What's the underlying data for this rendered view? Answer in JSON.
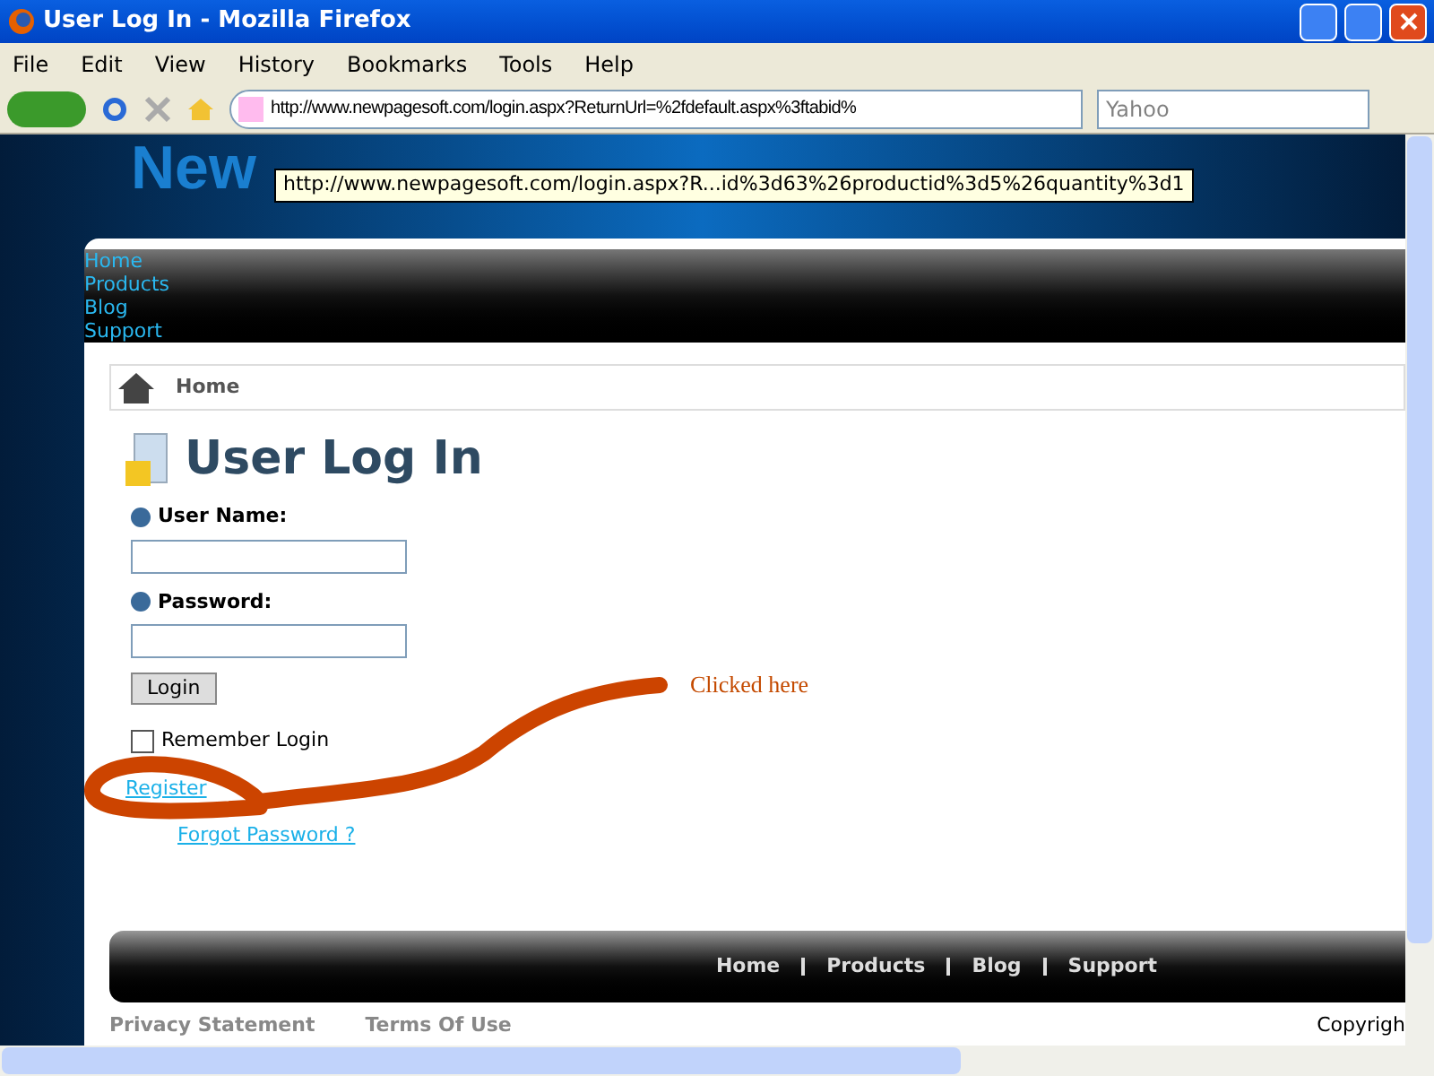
{
  "window": {
    "title": "User Log In - Mozilla Firefox"
  },
  "menu": [
    "File",
    "Edit",
    "View",
    "History",
    "Bookmarks",
    "Tools",
    "Help"
  ],
  "address": {
    "value": "http://www.newpagesoft.com/login.aspx?ReturnUrl=%2fdefault.aspx%3ftabid%"
  },
  "search": {
    "placeholder": "Yahoo"
  },
  "logo": {
    "parts": [
      {
        "text": "New",
        "color": "#1a7fd0"
      }
    ]
  },
  "tooltip": "http://www.newpagesoft.com/login.aspx?R...id%3d63%26productid%3d5%26quantity%3d1",
  "nav": [
    "Home",
    "Products",
    "Blog",
    "Support"
  ],
  "breadcrumb": "Home",
  "heading": "User Log In",
  "form": {
    "username_label": "User Name:",
    "password_label": "Password:",
    "login_button": "Login",
    "remember": {
      "label": "Remember Login",
      "checked": false
    },
    "register": "Register",
    "forgot": "Forgot Password ?"
  },
  "annotation": "Clicked here",
  "footer": {
    "nav": [
      "Home",
      "Products",
      "Blog",
      "Support"
    ],
    "links": [
      "Privacy Statement",
      "Terms Of Use"
    ],
    "copyright": "Copyrigh"
  }
}
